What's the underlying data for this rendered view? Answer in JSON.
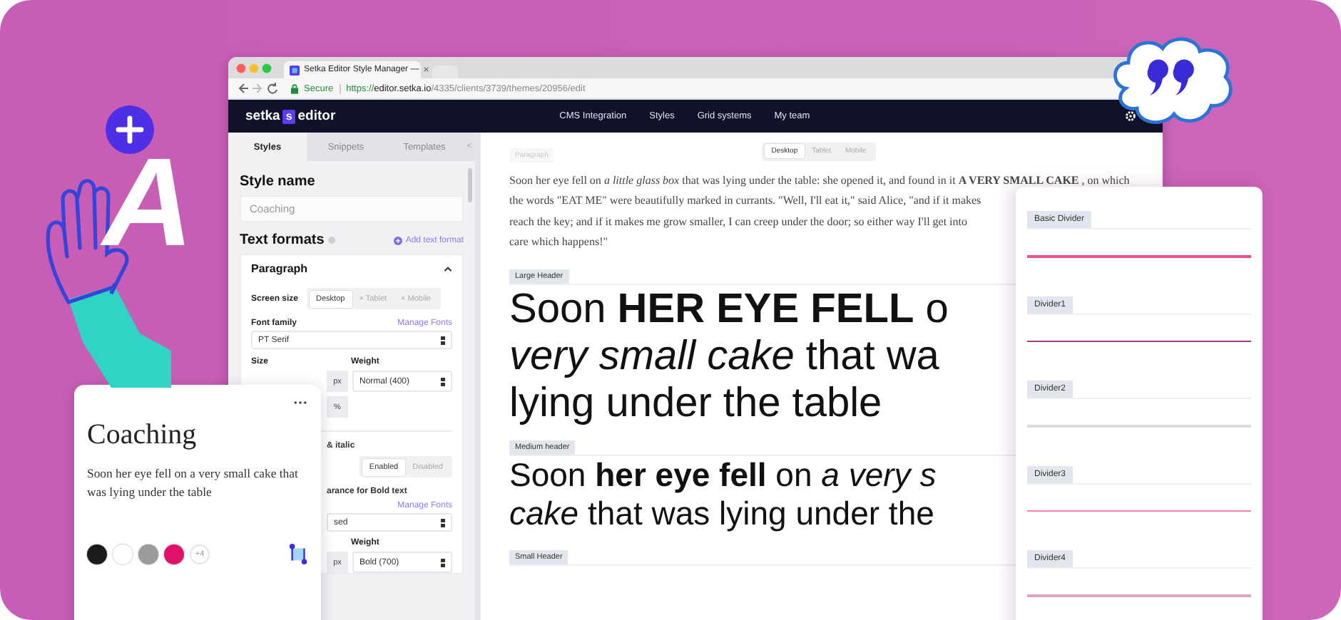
{
  "browser": {
    "tab_title": "Setka Editor Style Manager —",
    "tab_close": "×",
    "secure_label": "Secure",
    "url": {
      "scheme": "https://",
      "host": "editor.setka.io",
      "path": "/4335/clients/3739/themes/20956/edit"
    },
    "logo": {
      "left": "setka",
      "mark": "s",
      "right": "editor"
    },
    "nav": [
      "CMS Integration",
      "Styles",
      "Grid systems",
      "My team"
    ]
  },
  "sidebar": {
    "tabs": [
      {
        "label": "Styles",
        "selected": true
      },
      {
        "label": "Snippets",
        "selected": false
      },
      {
        "label": "Templates",
        "selected": false
      }
    ],
    "collapse": "<",
    "style_name_label": "Style name",
    "style_name_value": "Coaching",
    "text_formats_title": "Text formats",
    "add_format": "Add text format",
    "format_title": "Paragraph",
    "expanded": true,
    "screen_size_label": "Screen size",
    "screen_sizes": [
      {
        "label": "Desktop",
        "selected": true
      },
      {
        "label": "× Tablet",
        "selected": false
      },
      {
        "label": "× Mobile",
        "selected": false
      }
    ],
    "font_family_label": "Font family",
    "manage_fonts": "Manage Fonts",
    "font_family": "PT Serif",
    "size_label": "Size",
    "weight_label": "Weight",
    "size_unit": "px",
    "weight": "Normal (400)",
    "line_unit": "%",
    "italic_label": "& italic",
    "toggle": [
      {
        "label": "Enabled",
        "selected": true
      },
      {
        "label": "Disabled",
        "selected": false
      }
    ],
    "bold_label": "arance for Bold text",
    "manage_fonts_2": "Manage Fonts",
    "bold_font": "sed",
    "bold_weight_label": "Weight",
    "bold_unit": "px",
    "bold_weight": "Bold (700)"
  },
  "preview": {
    "ghost_tag": "Paragraph",
    "devices": [
      {
        "label": "Desktop",
        "selected": true
      },
      {
        "label": "Tablet",
        "selected": false
      },
      {
        "label": "Mobile",
        "selected": false
      }
    ],
    "paragraph_lines": [
      "Soon her eye fell on *a little glass box* that was lying under the table: she opened it, and found in it **A VERY SMALL CAKE** , on which",
      "the words \"EAT ME\" were beautifully marked in currants. \"Well, I'll eat it,\" said Alice, \"and if it makes",
      "reach the key; and if it makes me grow smaller, I can creep under the door; so either way I'll get into",
      "care which happens!\""
    ],
    "sections": [
      {
        "tag": "Large Header",
        "kind": "large",
        "lines": [
          "Soon **HER EYE FELL** o",
          "*very small cake* that wa",
          "lying under the table"
        ]
      },
      {
        "tag": "Medium header",
        "kind": "medium",
        "lines": [
          "Soon **her eye fell** on *a very s*",
          "*cake* that was lying under the"
        ]
      },
      {
        "tag": "Small Header",
        "kind": "small"
      }
    ]
  },
  "dividers_card": {
    "items": [
      {
        "label": "Basic Divider",
        "color": "#ec4f8e"
      },
      {
        "label": "Divider1",
        "color": "#a23d7e"
      },
      {
        "label": "Divider2",
        "color": "#dcdce0"
      },
      {
        "label": "Divider3",
        "color": "#f27faa"
      },
      {
        "label": "Divider4",
        "color": "#d9a6c6"
      }
    ]
  },
  "style_card": {
    "title": "Coaching",
    "text": "Soon her eye fell on a very small cake that was lying under the table",
    "swatches": [
      {
        "color": "#1b1b1b"
      },
      {
        "color": "#ffffff"
      },
      {
        "color": "#9b9b9b"
      },
      {
        "color": "#e1116b"
      }
    ],
    "more": "+4"
  },
  "decoration": {
    "letter": "A"
  }
}
